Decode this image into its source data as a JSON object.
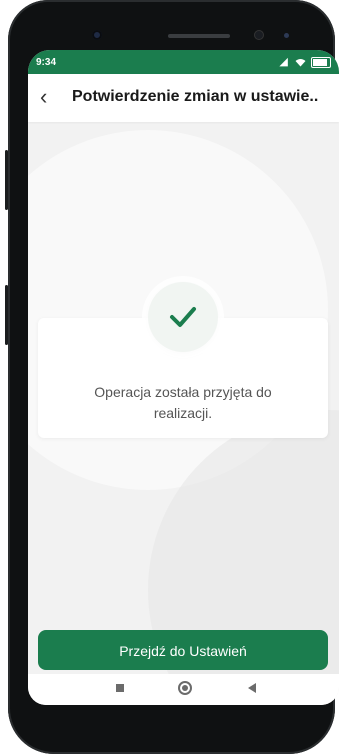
{
  "status_bar": {
    "time": "9:34",
    "signal_icon": "signal-icon",
    "wifi_icon": "wifi-icon",
    "battery_icon": "battery-icon"
  },
  "header": {
    "back_icon": "chevron-left-icon",
    "title": "Potwierdzenie zmian w ustawie.."
  },
  "confirmation": {
    "icon": "checkmark-icon",
    "message": "Operacja została przyjęta do realizacji."
  },
  "actions": {
    "primary_label": "Przejdź do Ustawień"
  },
  "nav": {
    "recents_icon": "recents-square-icon",
    "home_icon": "home-circle-icon",
    "back_icon": "back-triangle-icon"
  },
  "colors": {
    "brand": "#1b7d4e",
    "check": "#1b7d4e",
    "background": "#f2f2f2"
  }
}
